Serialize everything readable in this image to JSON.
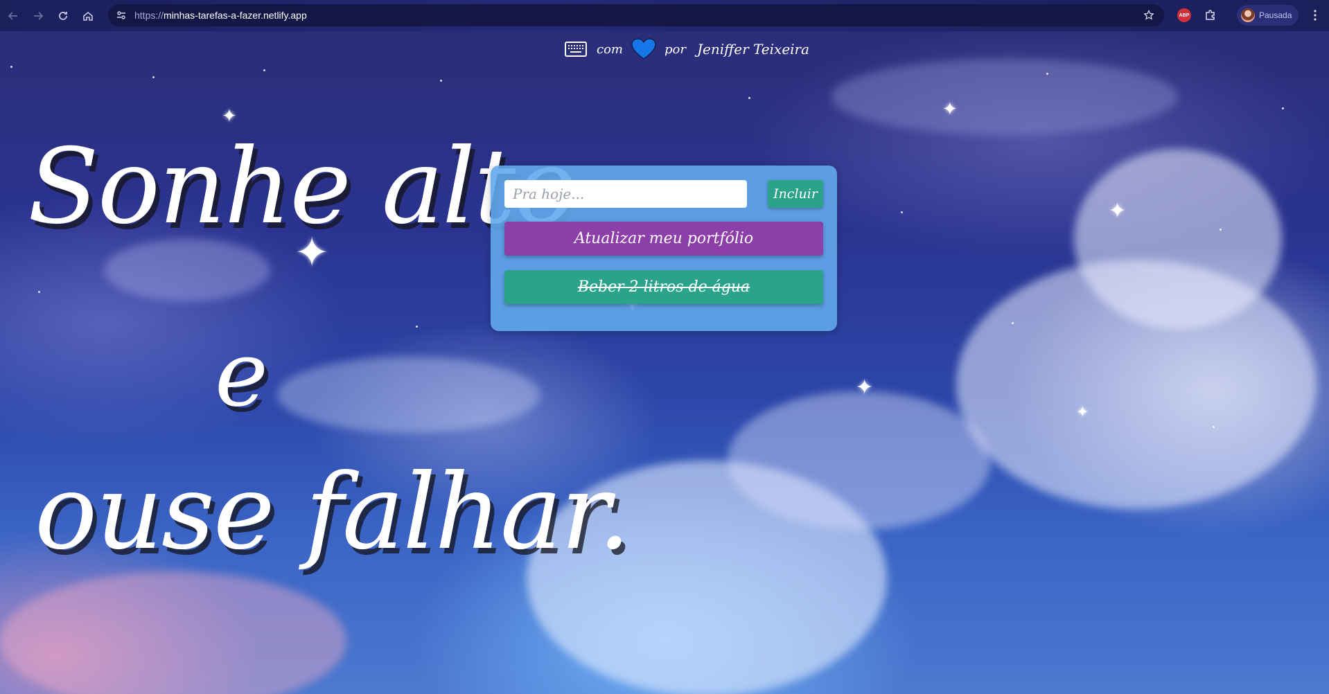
{
  "browser": {
    "url_scheme": "https://",
    "url_host": "minhas-tarefas-a-fazer.netlify.app",
    "extension_label": "ABP",
    "profile_status": "Pausada",
    "icons": [
      "back-arrow-icon",
      "forward-arrow-icon",
      "reload-icon",
      "home-icon",
      "site-info-icon",
      "star-icon",
      "adblock-plus-icon",
      "puzzle-icon",
      "avatar",
      "kebab-menu-icon"
    ]
  },
  "credits": {
    "with": "com",
    "by": "por",
    "author": "Jeniffer Teixeira",
    "icons": [
      "keyboard-icon",
      "heart-icon"
    ],
    "heart_color": "#1677e8"
  },
  "motto": {
    "line1": "Sonhe alto",
    "line2": "e",
    "line3": "ouse falhar."
  },
  "todo": {
    "input_placeholder": "Pra hoje...",
    "add_label": "Incluir",
    "tasks": [
      {
        "text": "Atualizar meu portfólio",
        "done": false,
        "color": "#8c3fa8"
      },
      {
        "text": "Beber 2 litros de água",
        "done": true,
        "color": "#2aa38a"
      }
    ]
  },
  "colors": {
    "card": "#62a8eb",
    "button_green": "#2aa38a",
    "task_purple": "#8c3fa8"
  }
}
